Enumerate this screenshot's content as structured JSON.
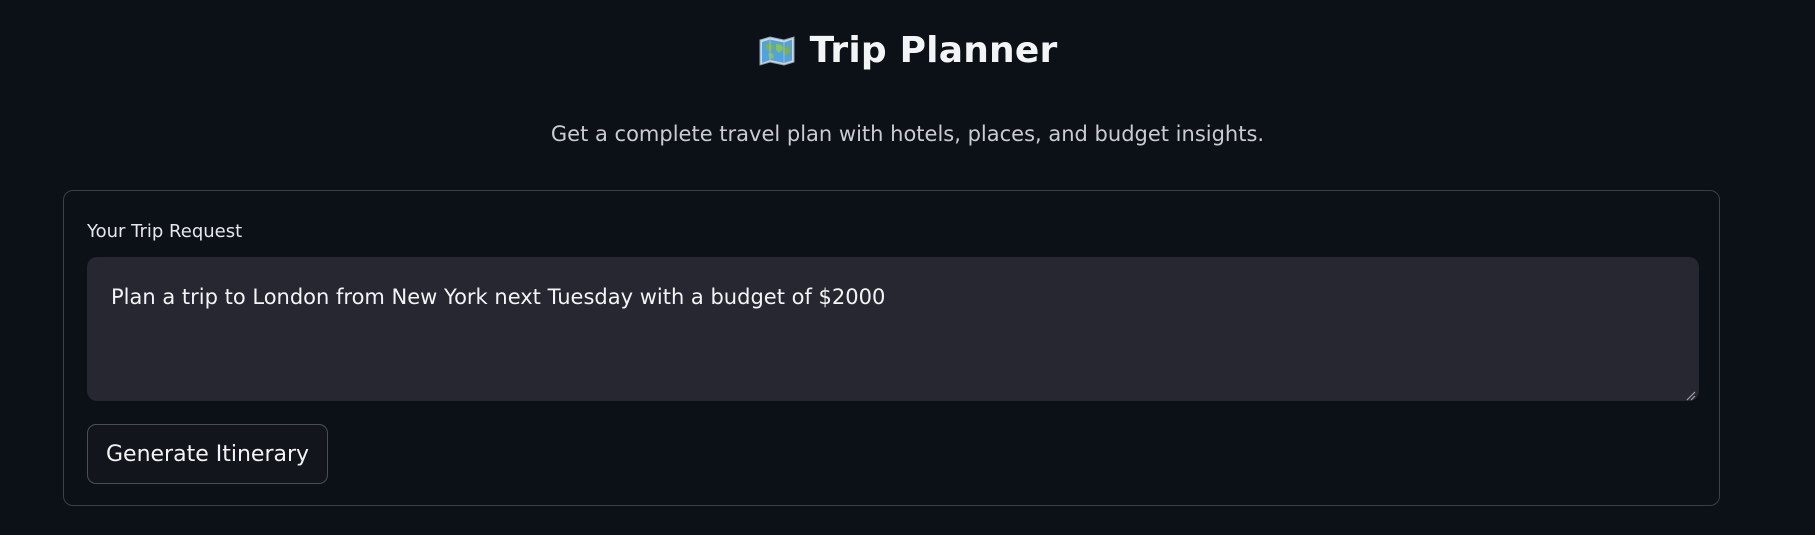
{
  "header": {
    "icon": "world-map-icon",
    "title": "Trip Planner",
    "subtitle": "Get a complete travel plan with hotels, places, and budget insights."
  },
  "form": {
    "label": "Your Trip Request",
    "request_value": "Plan a trip to London from New York next Tuesday with a budget of $2000",
    "submit_label": "Generate Itinerary"
  },
  "colors": {
    "background": "#0c1017",
    "input_background": "#262730",
    "border": "#3b3f47",
    "text": "#f3f4f6"
  }
}
